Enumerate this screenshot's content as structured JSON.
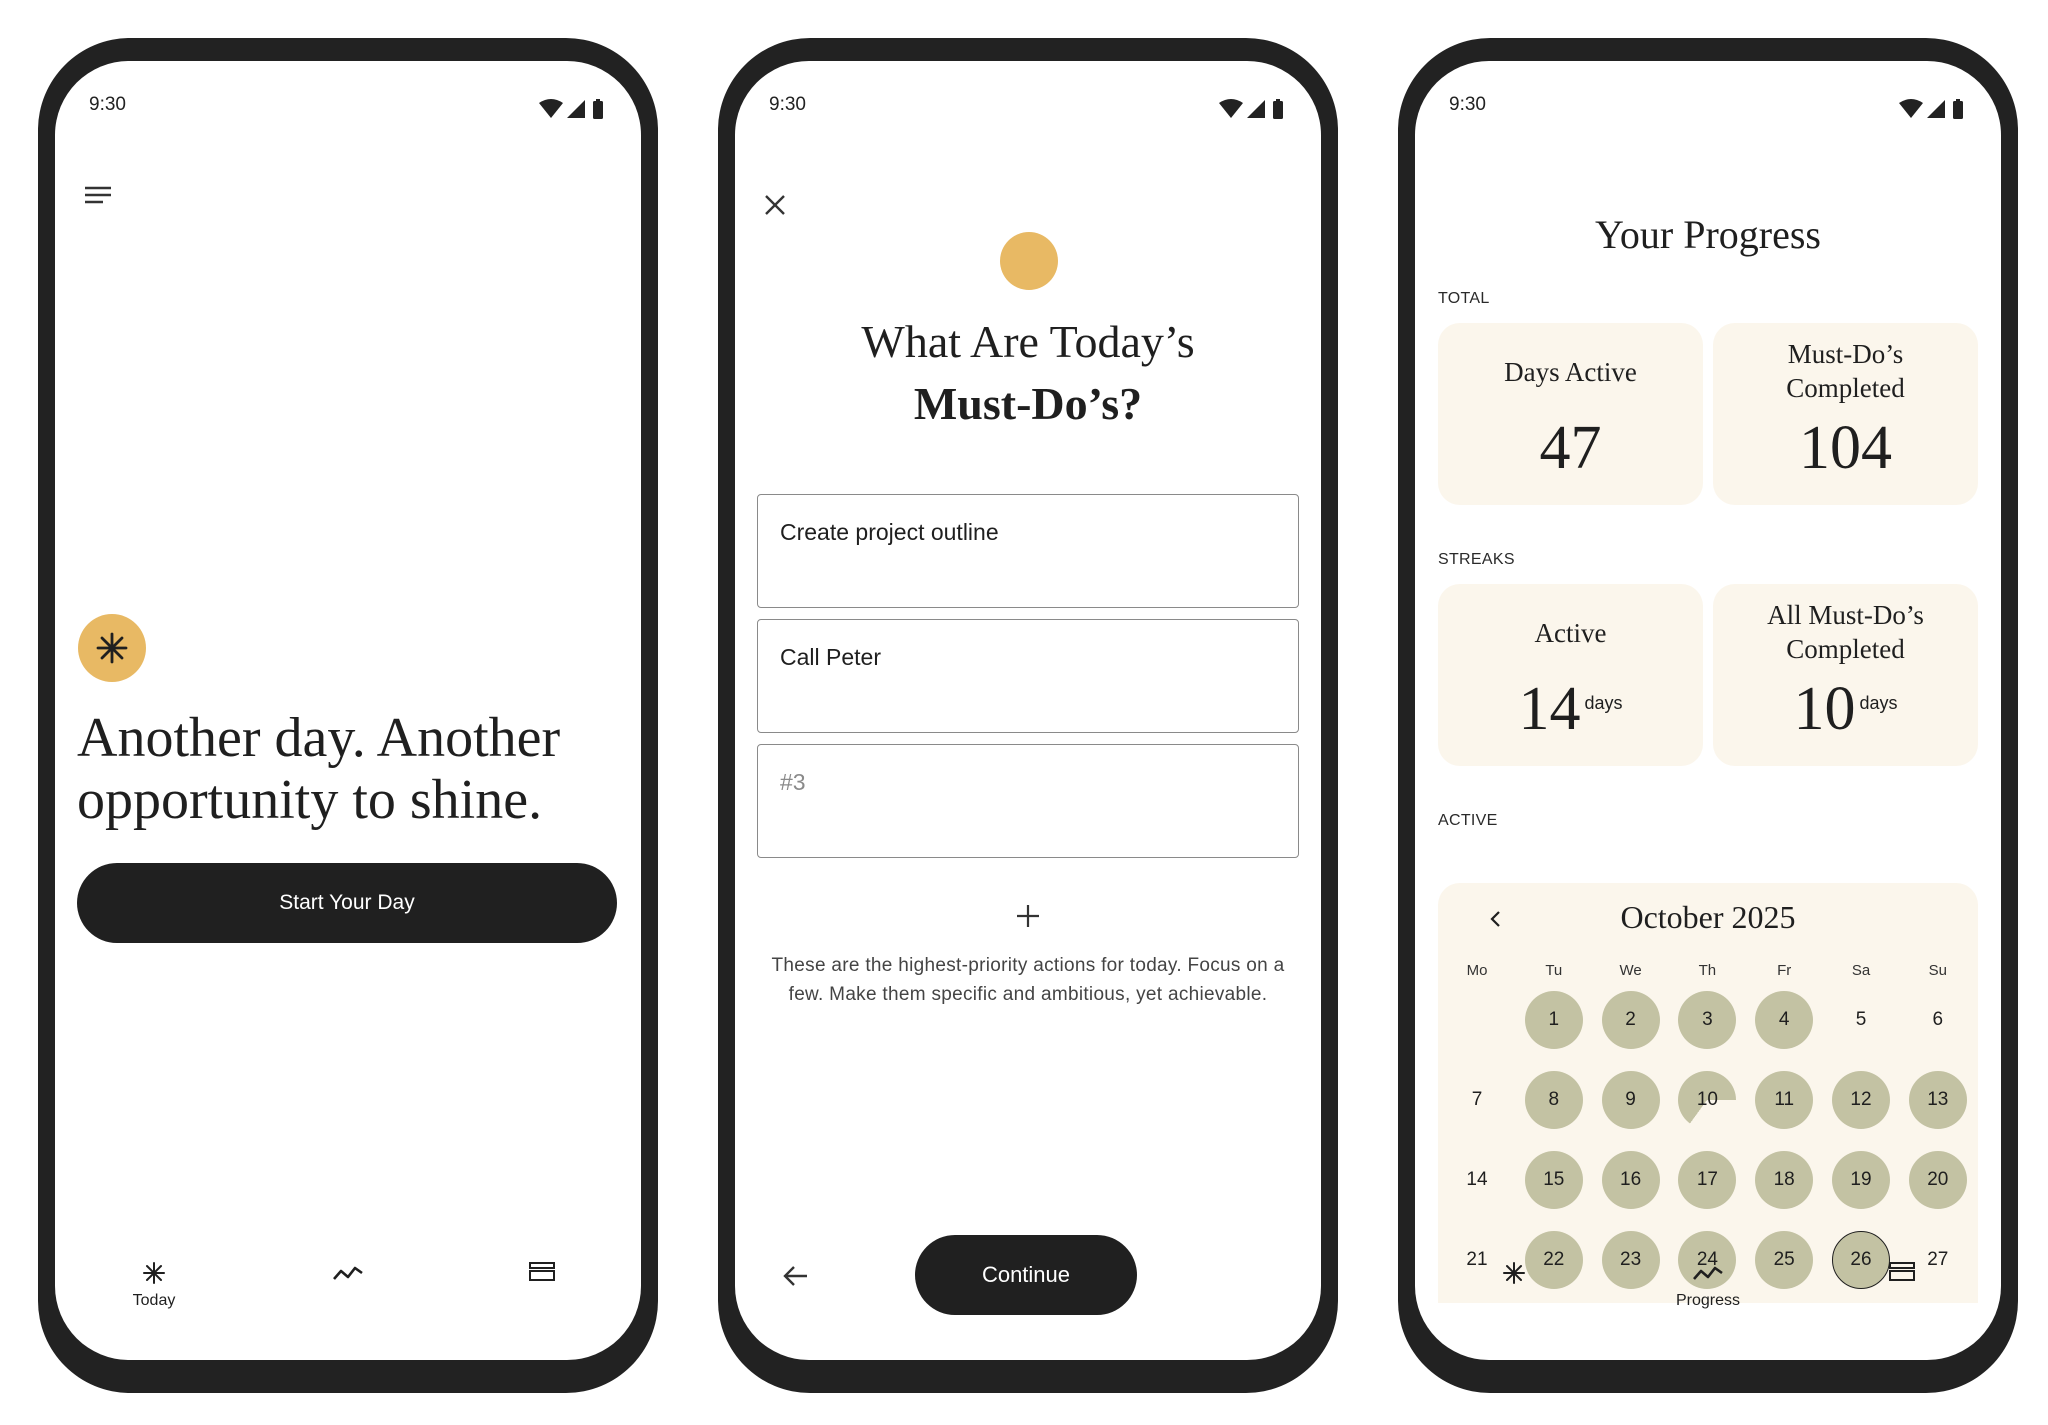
{
  "status": {
    "time": "9:30"
  },
  "screen1": {
    "headline": "Another day. Another opportunity to shine.",
    "start_button": "Start Your Day",
    "nav": {
      "today": "Today"
    }
  },
  "screen2": {
    "title_line1": "What Are Today’s",
    "title_line2": "Must-Do’s?",
    "tasks": [
      {
        "value": "Create project outline",
        "placeholder": ""
      },
      {
        "value": "Call Peter",
        "placeholder": ""
      },
      {
        "value": "",
        "placeholder": "#3"
      }
    ],
    "helper_text": "These are the highest-priority actions for today. Focus on a few. Make them specific and ambitious, yet achievable.",
    "continue_button": "Continue"
  },
  "screen3": {
    "title": "Your Progress",
    "total_label": "TOTAL",
    "streaks_label": "STREAKS",
    "active_label": "ACTIVE",
    "cards": {
      "days_active": {
        "title": "Days Active",
        "value": "47"
      },
      "must_dos_completed": {
        "title": "Must-Do’s Completed",
        "value": "104"
      },
      "active_streak": {
        "title": "Active",
        "value": "14",
        "unit": "days"
      },
      "all_completed_streak": {
        "title": "All Must-Do’s Completed",
        "value": "10",
        "unit": "days"
      }
    },
    "calendar": {
      "month": "October 2025",
      "weekdays": [
        "Mo",
        "Tu",
        "We",
        "Th",
        "Fr",
        "Sa",
        "Su"
      ],
      "rows": [
        [
          "",
          "1",
          "2",
          "3",
          "4",
          "5",
          "6"
        ],
        [
          "7",
          "8",
          "9",
          "10",
          "11",
          "12",
          "13"
        ],
        [
          "14",
          "15",
          "16",
          "17",
          "18",
          "19",
          "20"
        ],
        [
          "21",
          "22",
          "23",
          "24",
          "25",
          "26",
          "27"
        ]
      ],
      "active_days": [
        1,
        2,
        3,
        4,
        8,
        9,
        11,
        12,
        13,
        15,
        16,
        17,
        18,
        19,
        20,
        22,
        23,
        24,
        25,
        26
      ],
      "partial_days": [
        10
      ],
      "today": 26
    },
    "nav": {
      "progress": "Progress"
    }
  },
  "colors": {
    "accent": "#e8b964",
    "dark": "#202020",
    "card": "#fbf6ec",
    "active_day": "#c3c2a3"
  }
}
